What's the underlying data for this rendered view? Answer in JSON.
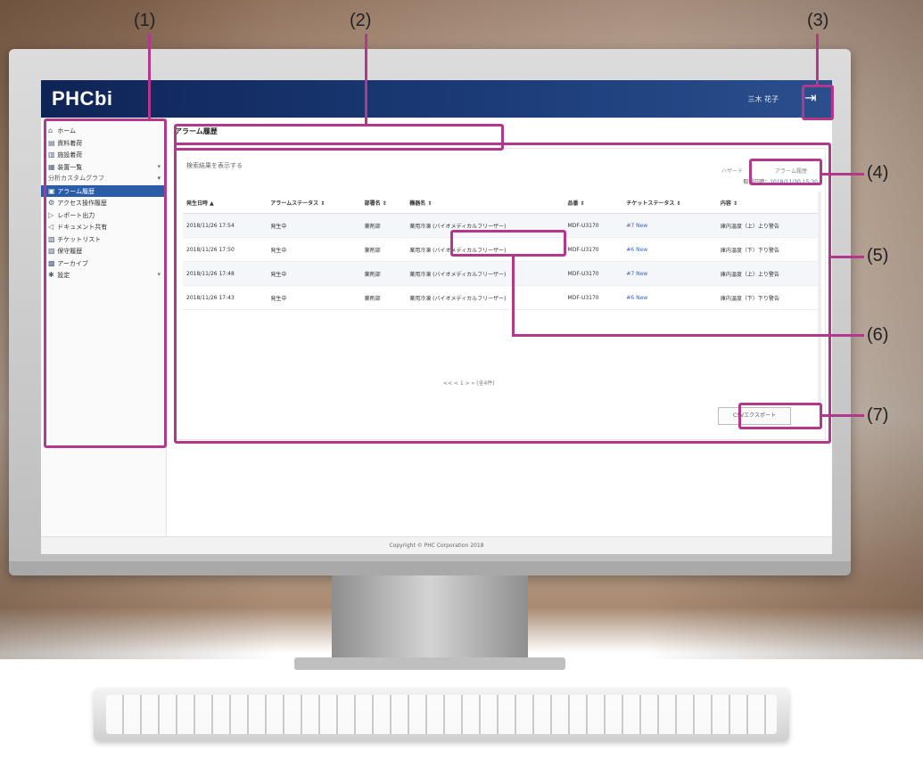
{
  "callouts": [
    "(1)",
    "(2)",
    "(3)",
    "(4)",
    "(5)",
    "(6)",
    "(7)"
  ],
  "app": {
    "logo": "PHCbi",
    "user": "三木 花子"
  },
  "sidebar": {
    "items": [
      {
        "label": "ホーム",
        "icon": "home-icon"
      },
      {
        "label": "資料着荷",
        "icon": "document-icon"
      },
      {
        "label": "施設着荷",
        "icon": "building-icon"
      },
      {
        "label": "装置一覧",
        "icon": "grid-icon",
        "chev": "▾"
      }
    ],
    "section": "分析カスタムグラフ",
    "section_chev": "▾",
    "items2": [
      {
        "label": "アラーム履歴",
        "icon": "bell-icon",
        "active": true
      },
      {
        "label": "アクセス操作履歴",
        "icon": "gear-icon"
      },
      {
        "label": "レポート出力",
        "icon": "report-icon"
      },
      {
        "label": "ドキュメント共有",
        "icon": "share-icon"
      },
      {
        "label": "チケットリスト",
        "icon": "ticket-icon"
      },
      {
        "label": "保守履歴",
        "icon": "history-icon"
      },
      {
        "label": "アーカイブ",
        "icon": "archive-icon"
      },
      {
        "label": "設定",
        "icon": "settings-icon",
        "chev": "▾"
      }
    ]
  },
  "main": {
    "title": "アラーム履歴",
    "export_link": "検索結果を表示する",
    "tabs": [
      "ハザード",
      "アラーム履歴"
    ],
    "updated_label": "取得日時：",
    "updated_value": "2018/11/30 15:30",
    "table": {
      "headers": [
        "発生日時 ▲",
        "アラームステータス ⇕",
        "部署名 ⇕",
        "機器名 ⇕",
        "品番 ⇕",
        "チケットステータス ⇕",
        "内容 ⇕"
      ],
      "rows": [
        [
          "2018/11/26 17:54",
          "発生中",
          "薬剤部",
          "薬用冷凍 (バイオメディカルフリーザー)",
          "MDF-U3170",
          "#7 New",
          "庫内温度（上）上り警告"
        ],
        [
          "2018/11/26 17:50",
          "発生中",
          "薬剤部",
          "薬用冷凍 (バイオメディカルフリーザー)",
          "MDF-U3170",
          "#6 New",
          "庫内温度（下）下り警告"
        ],
        [
          "2018/11/26 17:48",
          "発生中",
          "薬剤部",
          "薬用冷凍 (バイオメディカルフリーザー)",
          "MDF-U3170",
          "#7 New",
          "庫内温度（上）上り警告"
        ],
        [
          "2018/11/26 17:43",
          "発生中",
          "薬剤部",
          "薬用冷凍 (バイオメディカルフリーザー)",
          "MDF-U3170",
          "#6 New",
          "庫内温度（下）下り警告"
        ]
      ]
    },
    "pager": "<< < 1 > » (全4件)",
    "export_button": "CSVエクスポート"
  },
  "footer": "Copyright © PHC Corporation 2018"
}
